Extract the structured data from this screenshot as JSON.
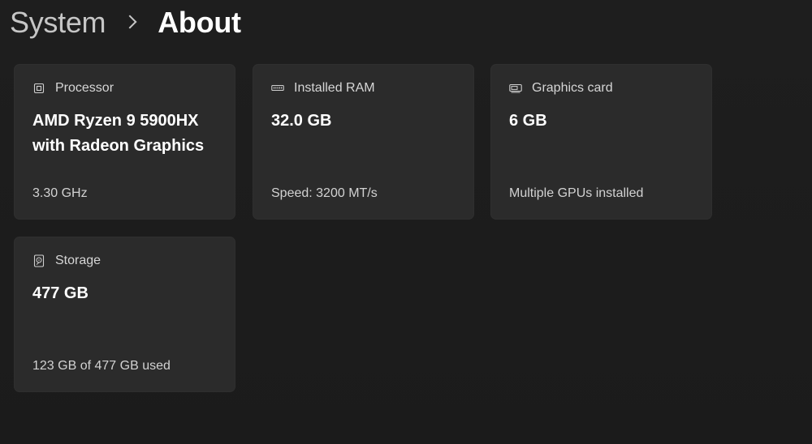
{
  "breadcrumb": {
    "parent": "System",
    "current": "About"
  },
  "cards": {
    "processor": {
      "icon": "processor-icon",
      "label": "Processor",
      "value": "AMD Ryzen 9 5900HX with Radeon Graphics",
      "detail": "3.30 GHz"
    },
    "ram": {
      "icon": "ram-icon",
      "label": "Installed RAM",
      "value": "32.0 GB",
      "detail": "Speed: 3200 MT/s"
    },
    "graphics": {
      "icon": "graphics-card-icon",
      "label": "Graphics card",
      "value": "6 GB",
      "detail": "Multiple GPUs installed"
    },
    "storage": {
      "icon": "storage-icon",
      "label": "Storage",
      "value": "477 GB",
      "detail": "123 GB of 477 GB used"
    }
  },
  "colors": {
    "background": "#1c1c1c",
    "card": "#2b2b2b",
    "text_primary": "#ffffff",
    "text_secondary": "#d2d2d2"
  }
}
